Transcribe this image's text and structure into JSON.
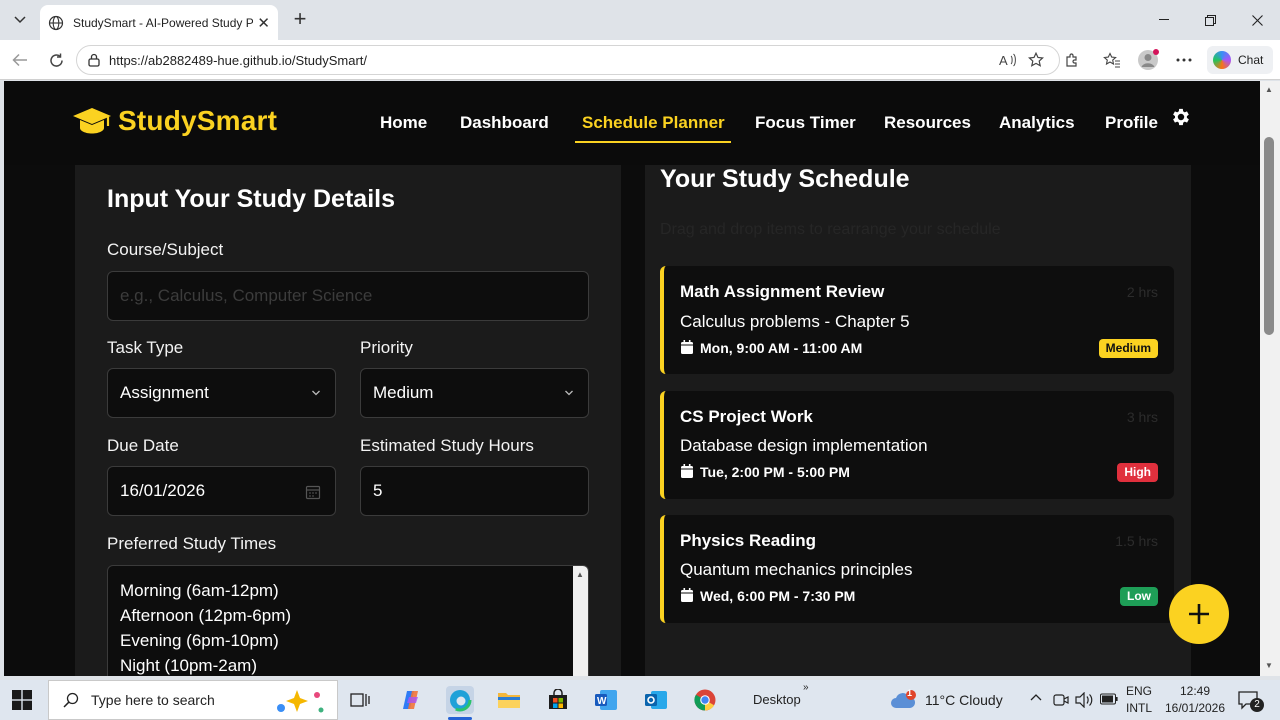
{
  "browser": {
    "tab_title": "StudySmart - AI-Powered Study Pl",
    "url": "https://ab2882489-hue.github.io/StudySmart/",
    "chat_label": "Chat"
  },
  "site": {
    "brand": "StudySmart",
    "nav": [
      "Home",
      "Dashboard",
      "Schedule Planner",
      "Focus Timer",
      "Resources",
      "Analytics",
      "Profile"
    ],
    "active_nav": "Schedule Planner",
    "accent": "#fbd221"
  },
  "form": {
    "heading": "Input Your Study Details",
    "course_label": "Course/Subject",
    "course_placeholder": "e.g., Calculus, Computer Science",
    "task_type_label": "Task Type",
    "task_type_value": "Assignment",
    "priority_label": "Priority",
    "priority_value": "Medium",
    "due_date_label": "Due Date",
    "due_date_value": "16/01/2026",
    "hours_label": "Estimated Study Hours",
    "hours_value": "5",
    "times_label": "Preferred Study Times",
    "times_options": [
      "Morning (6am-12pm)",
      "Afternoon (12pm-6pm)",
      "Evening (6pm-10pm)",
      "Night (10pm-2am)"
    ]
  },
  "schedule": {
    "heading": "Your Study Schedule",
    "hint": "Drag and drop items to rearrange your schedule",
    "items": [
      {
        "title": "Math Assignment Review",
        "hours": "2 hrs",
        "desc": "Calculus problems - Chapter 5",
        "when": "Mon, 9:00 AM - 11:00 AM",
        "priority": "Medium",
        "badge_bg": "#fbd221",
        "badge_fg": "#111111"
      },
      {
        "title": "CS Project Work",
        "hours": "3 hrs",
        "desc": "Database design implementation",
        "when": "Tue, 2:00 PM - 5:00 PM",
        "priority": "High",
        "badge_bg": "#e0303d",
        "badge_fg": "#ffffff"
      },
      {
        "title": "Physics Reading",
        "hours": "1.5 hrs",
        "desc": "Quantum mechanics principles",
        "when": "Wed, 6:00 PM - 7:30 PM",
        "priority": "Low",
        "badge_bg": "#1e9e57",
        "badge_fg": "#ffffff"
      }
    ]
  },
  "taskbar": {
    "search_placeholder": "Type here to search",
    "desktop_label": "Desktop",
    "weather": "11°C  Cloudy",
    "weather_badge": "1",
    "lang_1": "ENG",
    "lang_2": "INTL",
    "time": "12:49",
    "date": "16/01/2026",
    "notif_count": "2"
  }
}
